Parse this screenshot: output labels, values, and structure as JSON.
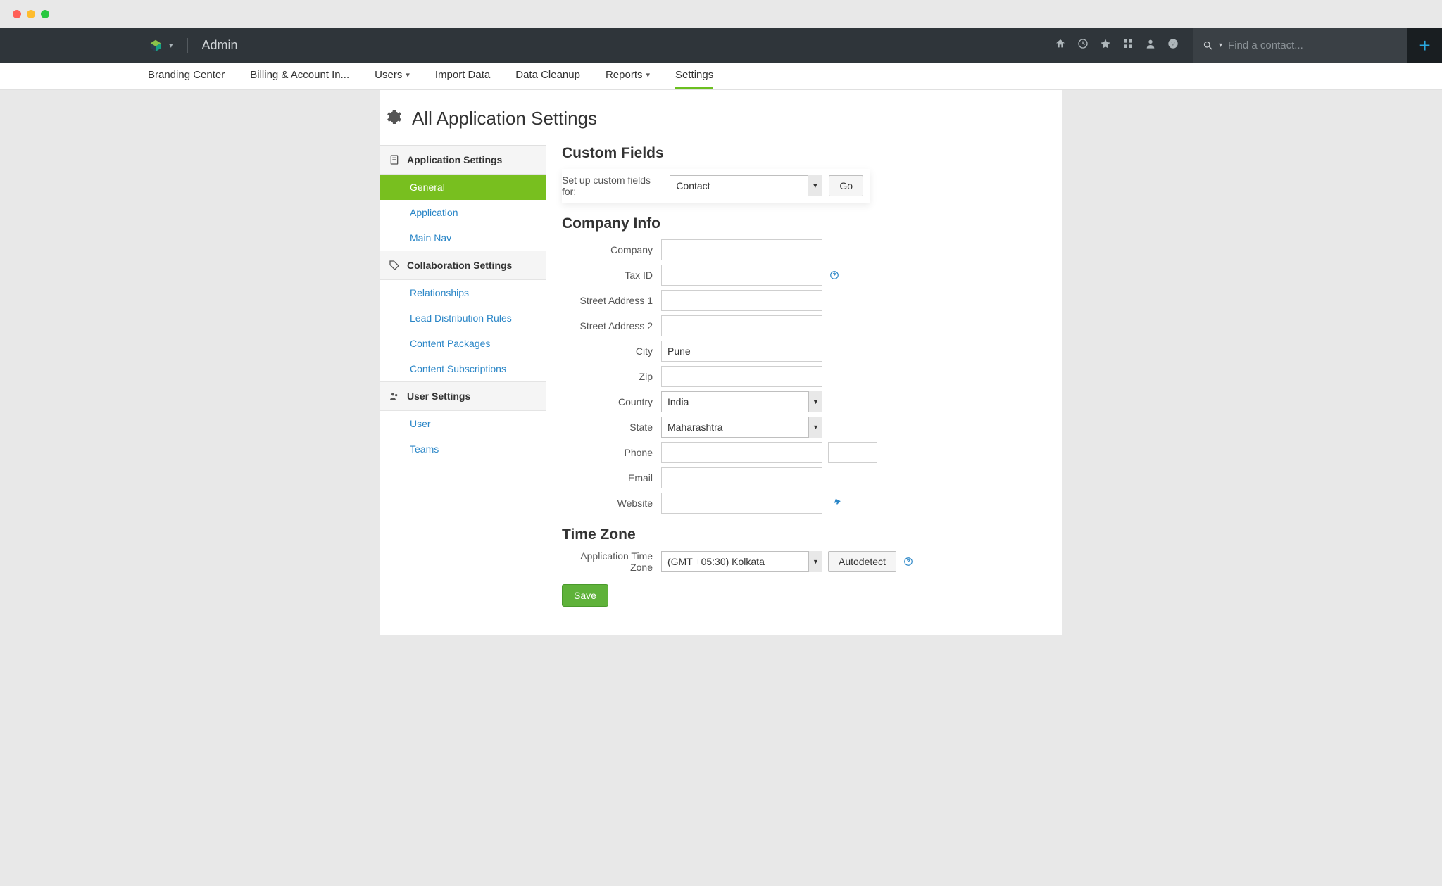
{
  "header": {
    "admin_label": "Admin",
    "search_placeholder": "Find a contact..."
  },
  "subnav": {
    "items": [
      "Branding Center",
      "Billing & Account In...",
      "Users",
      "Import Data",
      "Data Cleanup",
      "Reports",
      "Settings"
    ]
  },
  "page": {
    "title": "All Application Settings"
  },
  "sidebar": {
    "sections": [
      {
        "title": "Application Settings",
        "items": [
          "General",
          "Application",
          "Main Nav"
        ]
      },
      {
        "title": "Collaboration Settings",
        "items": [
          "Relationships",
          "Lead Distribution Rules",
          "Content Packages",
          "Content Subscriptions"
        ]
      },
      {
        "title": "User Settings",
        "items": [
          "User",
          "Teams"
        ]
      }
    ]
  },
  "custom_fields": {
    "heading": "Custom Fields",
    "label": "Set up custom fields for:",
    "selected": "Contact",
    "go": "Go"
  },
  "company_info": {
    "heading": "Company Info",
    "labels": {
      "company": "Company",
      "tax_id": "Tax ID",
      "addr1": "Street Address 1",
      "addr2": "Street Address 2",
      "city": "City",
      "zip": "Zip",
      "country": "Country",
      "state": "State",
      "phone": "Phone",
      "email": "Email",
      "website": "Website"
    },
    "values": {
      "company": "",
      "tax_id": "",
      "addr1": "",
      "addr2": "",
      "city": "Pune",
      "zip": "",
      "country": "India",
      "state": "Maharashtra",
      "phone": "",
      "email": "",
      "website": ""
    }
  },
  "timezone": {
    "heading": "Time Zone",
    "label": "Application Time Zone",
    "value": "(GMT +05:30) Kolkata",
    "autodetect": "Autodetect"
  },
  "save_label": "Save"
}
